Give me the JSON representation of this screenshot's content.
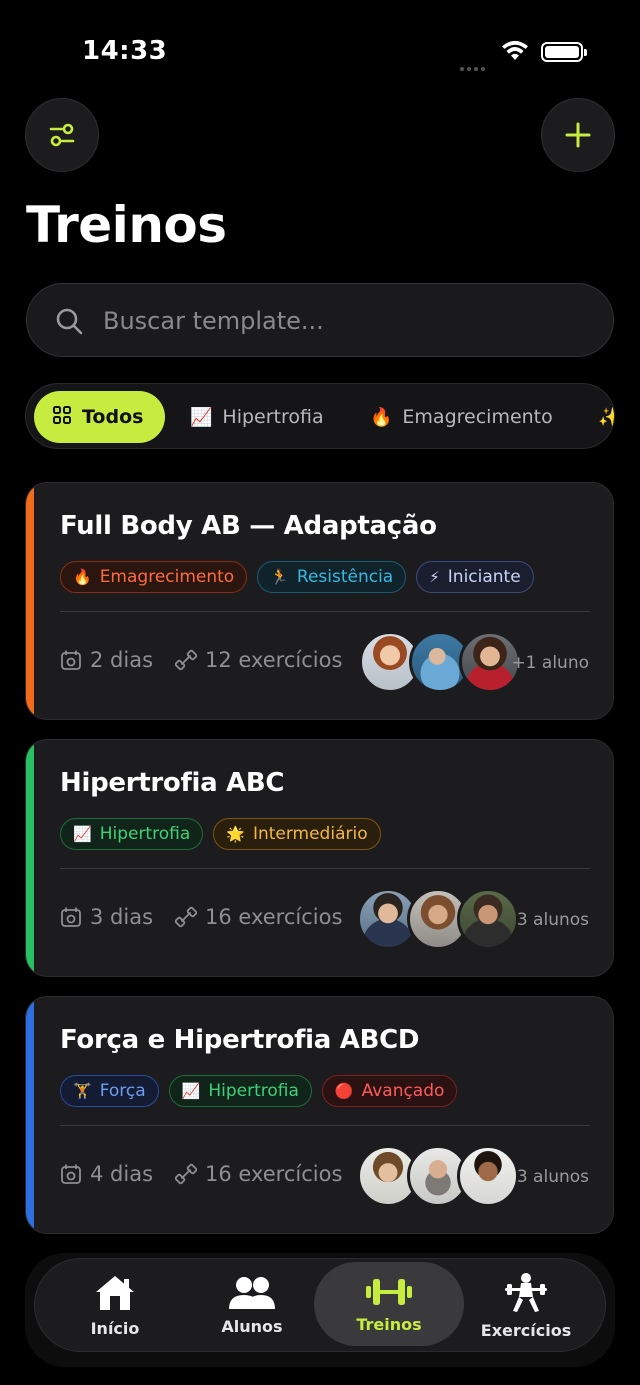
{
  "status_bar": {
    "time": "14:33"
  },
  "header": {
    "title": "Treinos"
  },
  "search": {
    "placeholder": "Buscar template..."
  },
  "filters": [
    {
      "label": "Todos",
      "icon": "grid-icon",
      "active": true
    },
    {
      "label": "Hipertrofia",
      "icon": "chart-up-emoji",
      "active": false
    },
    {
      "label": "Emagrecimento",
      "icon": "fire-emoji",
      "active": false
    },
    {
      "label": "",
      "icon": "sparkles-emoji",
      "active": false
    }
  ],
  "cards": [
    {
      "title": "Full Body AB — Adaptação",
      "accent": "#f26b1d",
      "tags": [
        {
          "label": "Emagrecimento",
          "icon": "🔥",
          "color": "#ff6a3d",
          "border": "#8a2e12",
          "bg": "#2a160f"
        },
        {
          "label": "Resistência",
          "icon": "🏃",
          "color": "#36b9e4",
          "border": "#185c74",
          "bg": "#10222a"
        },
        {
          "label": "Iniciante",
          "icon": "⚡",
          "color": "#c9d3f7",
          "border": "#3b4a7c",
          "bg": "#1a1e2e"
        }
      ],
      "days": "2 dias",
      "exercises": "12 exercícios",
      "students": "+1 aluno"
    },
    {
      "title": "Hipertrofia ABC",
      "accent": "#27c062",
      "tags": [
        {
          "label": "Hipertrofia",
          "icon": "📈",
          "color": "#3ed178",
          "border": "#1f6b3b",
          "bg": "#11241a"
        },
        {
          "label": "Intermediário",
          "icon": "🌟",
          "color": "#f4b740",
          "border": "#7d5510",
          "bg": "#2a1f0c"
        }
      ],
      "days": "3 dias",
      "exercises": "16 exercícios",
      "students": "3 alunos"
    },
    {
      "title": "Força e Hipertrofia ABCD",
      "accent": "#2f6ee0",
      "tags": [
        {
          "label": "Força",
          "icon": "🏋",
          "color": "#6f9cf5",
          "border": "#2a4a9a",
          "bg": "#131c33"
        },
        {
          "label": "Hipertrofia",
          "icon": "📈",
          "color": "#3ed178",
          "border": "#1f6b3b",
          "bg": "#11241a"
        },
        {
          "label": "Avançado",
          "icon": "🔴",
          "color": "#ff5a5a",
          "border": "#7e1f1f",
          "bg": "#2a1212"
        }
      ],
      "days": "4 dias",
      "exercises": "16 exercícios",
      "students": "3 alunos"
    }
  ],
  "tabbar": [
    {
      "label": "Início",
      "icon": "home-icon",
      "active": false
    },
    {
      "label": "Alunos",
      "icon": "users-icon",
      "active": false
    },
    {
      "label": "Treinos",
      "icon": "dumbbell-icon",
      "active": true
    },
    {
      "label": "Exercícios",
      "icon": "weightlifter-icon",
      "active": false
    }
  ],
  "colors": {
    "accent": "#c5ec3e",
    "background": "#000000",
    "card": "#1c1c1e"
  }
}
